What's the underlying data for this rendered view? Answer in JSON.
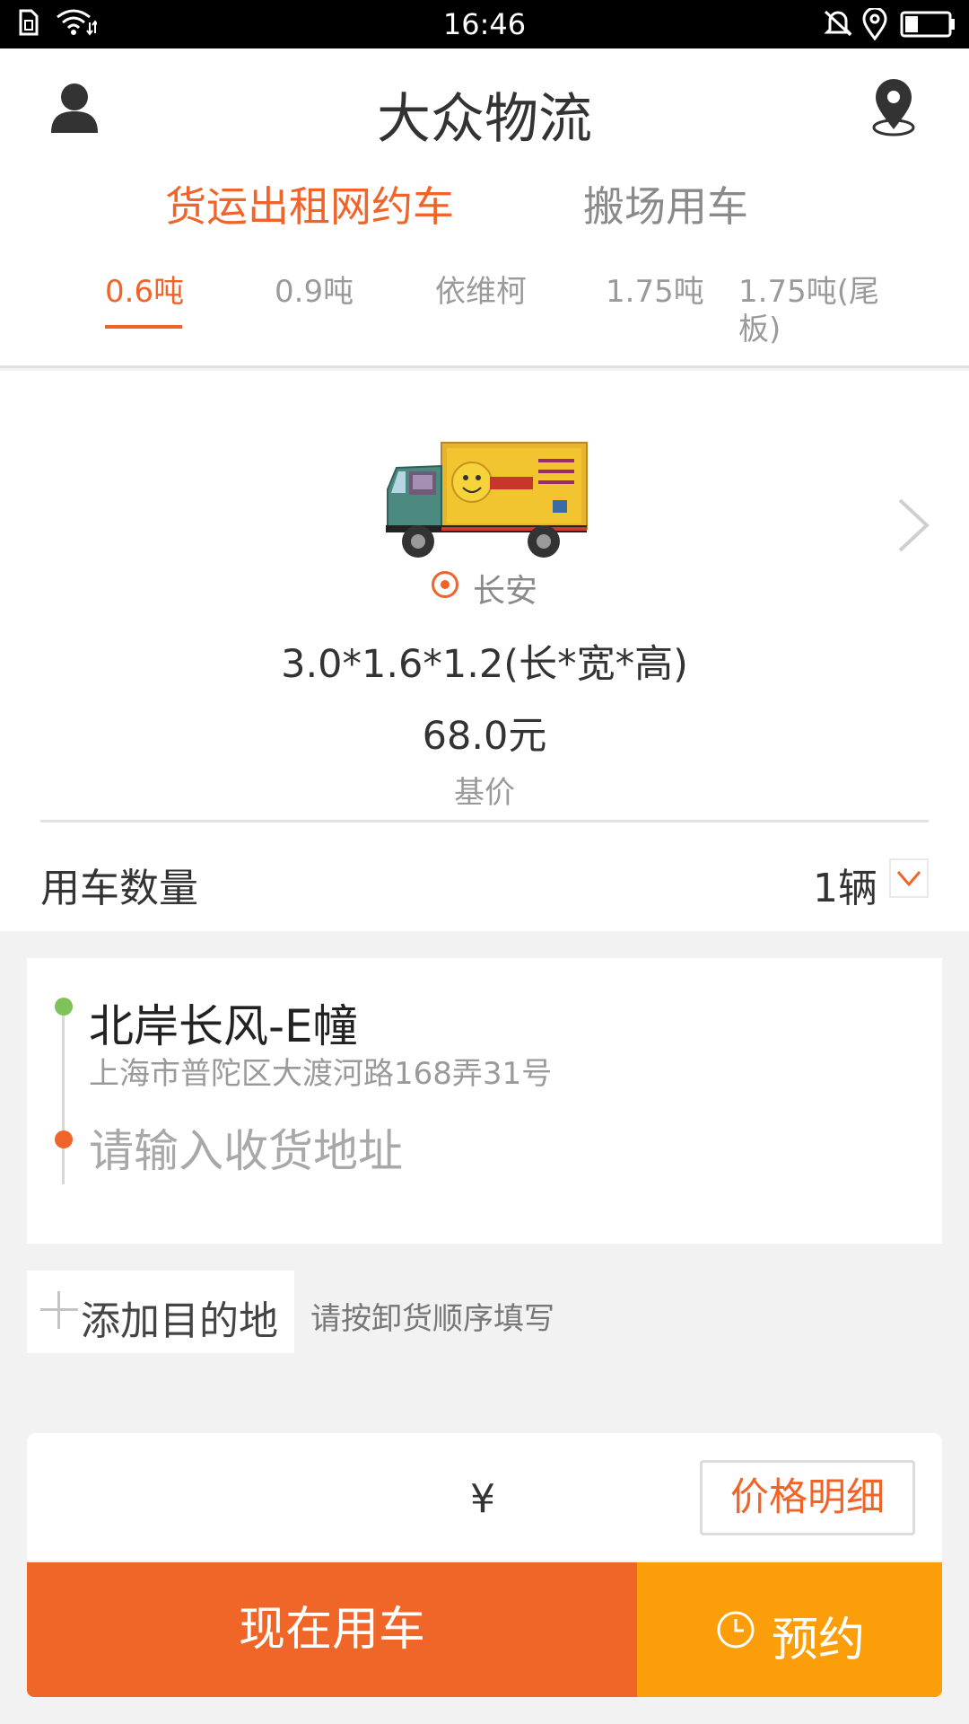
{
  "status_bar": {
    "time": "16:46"
  },
  "header": {
    "title": "大众物流",
    "tabs": [
      {
        "label": "货运出租网约车",
        "active": true
      },
      {
        "label": "搬场用车",
        "active": false
      }
    ],
    "tonnage_tabs": [
      {
        "label": "0.6吨",
        "active": true
      },
      {
        "label": "0.9吨",
        "active": false
      },
      {
        "label": "依维柯",
        "active": false
      },
      {
        "label": "1.75吨",
        "active": false
      },
      {
        "label": "1.75吨(尾板)",
        "active": false
      }
    ]
  },
  "vehicle": {
    "model": "长安",
    "dimensions": "3.0*1.6*1.2(长*宽*高)",
    "price": "68.0元",
    "price_label": "基价",
    "quantity_label": "用车数量",
    "quantity_value": "1辆"
  },
  "address": {
    "pickup_name": "北岸长风-E幢",
    "pickup_address": "上海市普陀区大渡河路168弄31号",
    "destination_placeholder": "请输入收货地址"
  },
  "add_destination": {
    "label": "添加目的地",
    "hint": "请按卸货顺序填写"
  },
  "price_bar": {
    "currency_symbol": "¥",
    "detail_button": "价格明细"
  },
  "actions": {
    "now_label": "现在用车",
    "book_label": "预约"
  },
  "colors": {
    "accent": "#f0642a",
    "book_button": "#fb9e09",
    "pickup_dot": "#7fc25a"
  },
  "icons": [
    "user-icon",
    "location-icon",
    "chevron-right-icon",
    "chevron-down-icon",
    "clock-icon",
    "plus-icon"
  ]
}
